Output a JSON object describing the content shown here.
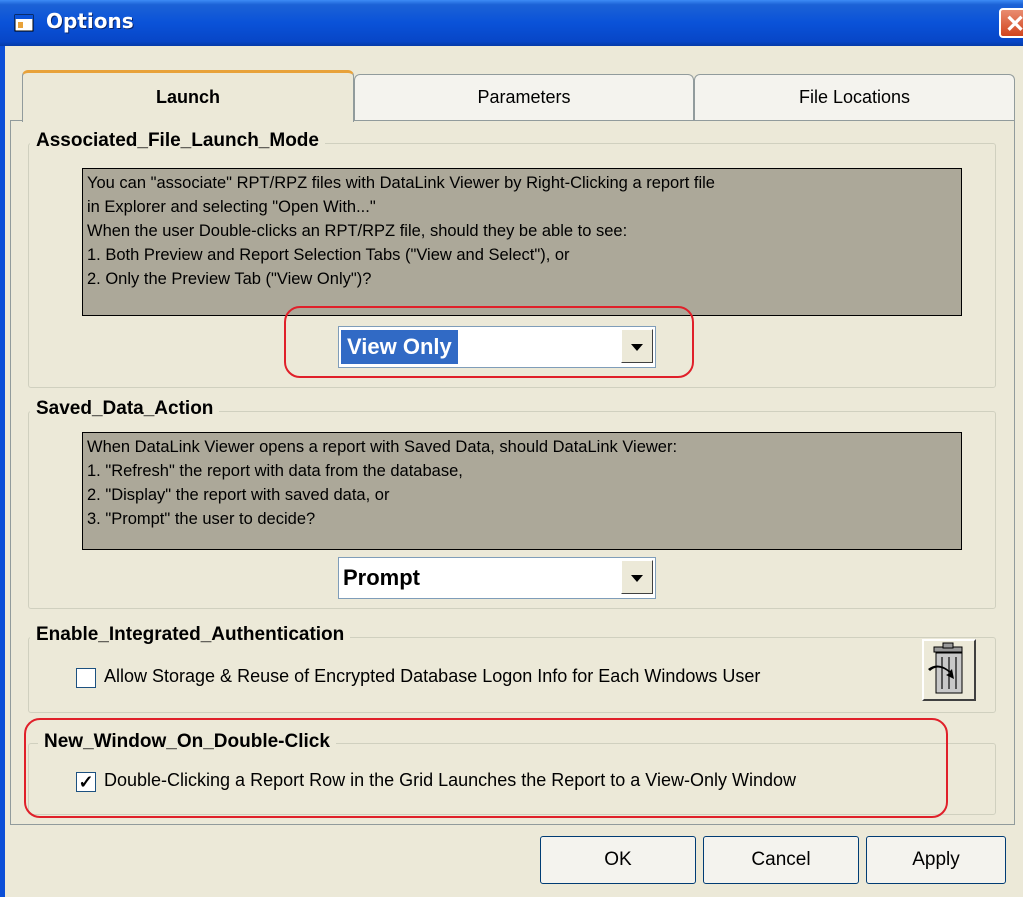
{
  "window": {
    "title": "Options",
    "close_label": "✕"
  },
  "tabs": [
    {
      "label": "Launch",
      "active": true
    },
    {
      "label": "Parameters",
      "active": false
    },
    {
      "label": "File Locations",
      "active": false
    }
  ],
  "associated": {
    "label": "Associated_File_Launch_Mode",
    "lines": [
      "You can \"associate\" RPT/RPZ files with DataLink Viewer by Right-Clicking a report file",
      "in Explorer and selecting \"Open With...\"",
      "When the user Double-clicks an RPT/RPZ file, should they be able to see:",
      "1. Both Preview and Report Selection Tabs (\"View and Select\"), or",
      "2. Only the Preview Tab (\"View Only\")?"
    ],
    "selected": "View Only"
  },
  "saved_data": {
    "label": "Saved_Data_Action",
    "lines": [
      "When DataLink Viewer opens a report with Saved Data, should DataLink Viewer:",
      "1. \"Refresh\" the report with data from the database,",
      "2. \"Display\" the report with saved data, or",
      "3. \"Prompt\" the user to decide?"
    ],
    "selected": "Prompt"
  },
  "integrated_auth": {
    "label": "Enable_Integrated_Authentication",
    "checkbox_label": "Allow Storage & Reuse of Encrypted Database Logon Info for Each Windows User",
    "checked": false
  },
  "new_window": {
    "label": "New_Window_On_Double-Click",
    "checkbox_label": "Double-Clicking a Report Row in the Grid Launches the Report to a View-Only Window",
    "checked": true
  },
  "buttons": {
    "ok": "OK",
    "cancel": "Cancel",
    "apply": "Apply"
  },
  "colors": {
    "titlebar": "#0A52D8",
    "highlight": "#E0202A",
    "selection": "#316AC5",
    "info_box": "#ACA899"
  }
}
